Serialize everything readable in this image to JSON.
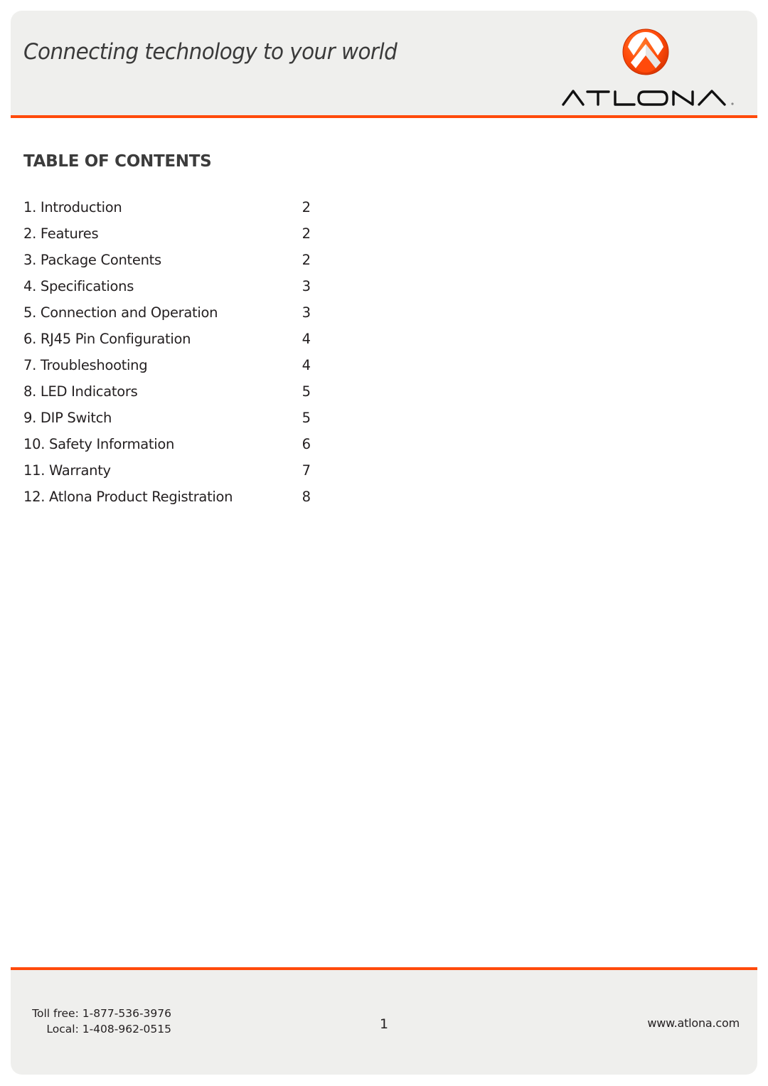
{
  "header": {
    "tagline": "Connecting technology to your world",
    "brand": {
      "name": "ATLONA",
      "logo_icon": "atlona-chevron-logo-icon",
      "accent_color": "#ff4a0b"
    }
  },
  "toc": {
    "title": "TABLE OF CONTENTS",
    "items": [
      {
        "label": "1. Introduction",
        "page": "2"
      },
      {
        "label": "2. Features",
        "page": "2"
      },
      {
        "label": "3. Package Contents",
        "page": "2"
      },
      {
        "label": "4. Specifications",
        "page": "3"
      },
      {
        "label": "5. Connection and Operation",
        "page": "3"
      },
      {
        "label": "6. RJ45 Pin Configuration",
        "page": "4"
      },
      {
        "label": "7. Troubleshooting",
        "page": "4"
      },
      {
        "label": "8. LED Indicators",
        "page": "5"
      },
      {
        "label": "9. DIP Switch",
        "page": "5"
      },
      {
        "label": "10. Safety Information",
        "page": "6"
      },
      {
        "label": "11. Warranty",
        "page": "7"
      },
      {
        "label": "12. Atlona Product Registration",
        "page": "8"
      }
    ]
  },
  "footer": {
    "toll_free": "Toll free: 1-877-536-3976",
    "local": "Local: 1-408-962-0515",
    "page_number": "1",
    "website": "www.atlona.com"
  }
}
